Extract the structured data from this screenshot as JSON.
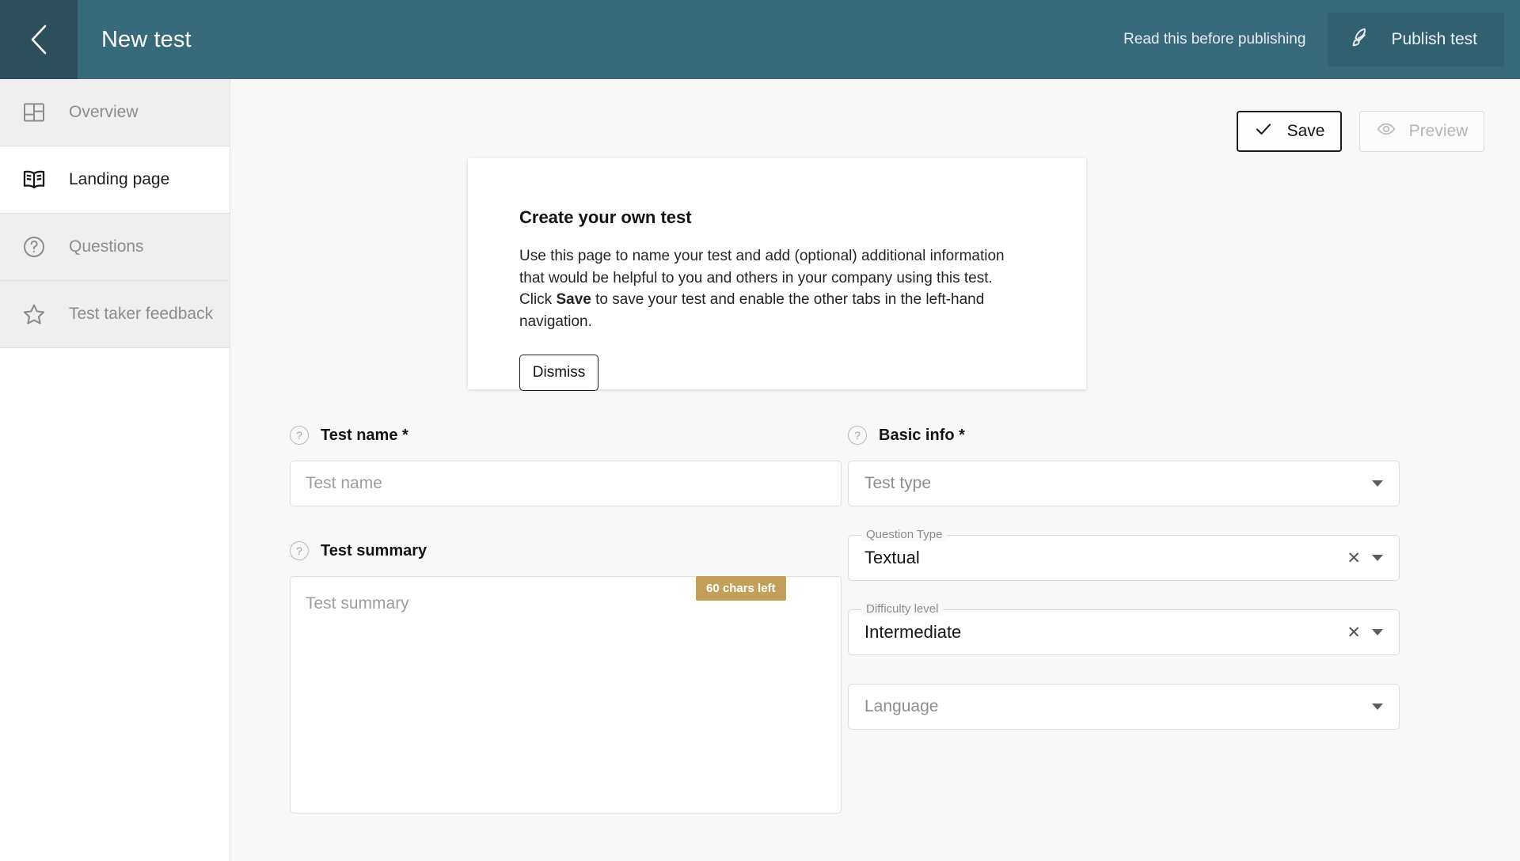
{
  "header": {
    "back_icon": "chevron-left-icon",
    "title": "New test",
    "read_link": "Read this before publishing",
    "publish_label": "Publish test",
    "publish_icon": "rocket-icon",
    "bg_color": "#376a7b",
    "back_bg_color": "#2d4f5c",
    "publish_bg_color": "#31606f"
  },
  "sidebar": {
    "items": [
      {
        "label": "Overview",
        "icon": "layout-grid-icon",
        "active": false
      },
      {
        "label": "Landing page",
        "icon": "open-book-icon",
        "active": true
      },
      {
        "label": "Questions",
        "icon": "question-circle-icon",
        "active": false
      },
      {
        "label": "Test taker feedback",
        "icon": "star-icon",
        "active": false
      }
    ]
  },
  "toolbar": {
    "save_label": "Save",
    "save_icon": "check-icon",
    "preview_label": "Preview",
    "preview_icon": "eye-icon"
  },
  "info_card": {
    "title": "Create your own test",
    "body_part1": "Use this page to name your test and add (optional) additional information that would be helpful to you and others in your company using this test. Click ",
    "body_bold": "Save",
    "body_part2": " to save your test and enable the other tabs in the left-hand navigation.",
    "dismiss_label": "Dismiss"
  },
  "form": {
    "test_name": {
      "label": "Test name *",
      "help_icon": "question-circle-icon",
      "value": "",
      "placeholder": "Test name",
      "chars_left_badge": "60 chars left",
      "badge_color": "#c3a05a"
    },
    "test_summary": {
      "label": "Test summary",
      "help_icon": "question-circle-icon",
      "value": "",
      "placeholder": "Test summary"
    },
    "basic_info": {
      "label": "Basic info *",
      "help_icon": "question-circle-icon",
      "test_type": {
        "placeholder": "Test type",
        "value": "",
        "caret_icon": "chevron-down-icon"
      },
      "question_type": {
        "notch_label": "Question Type",
        "value": "Textual",
        "clear_icon": "close-icon",
        "caret_icon": "chevron-down-icon"
      },
      "difficulty_level": {
        "notch_label": "Difficulty level",
        "value": "Intermediate",
        "clear_icon": "close-icon",
        "caret_icon": "chevron-down-icon"
      },
      "language": {
        "placeholder": "Language",
        "value": "",
        "caret_icon": "chevron-down-icon"
      }
    }
  }
}
